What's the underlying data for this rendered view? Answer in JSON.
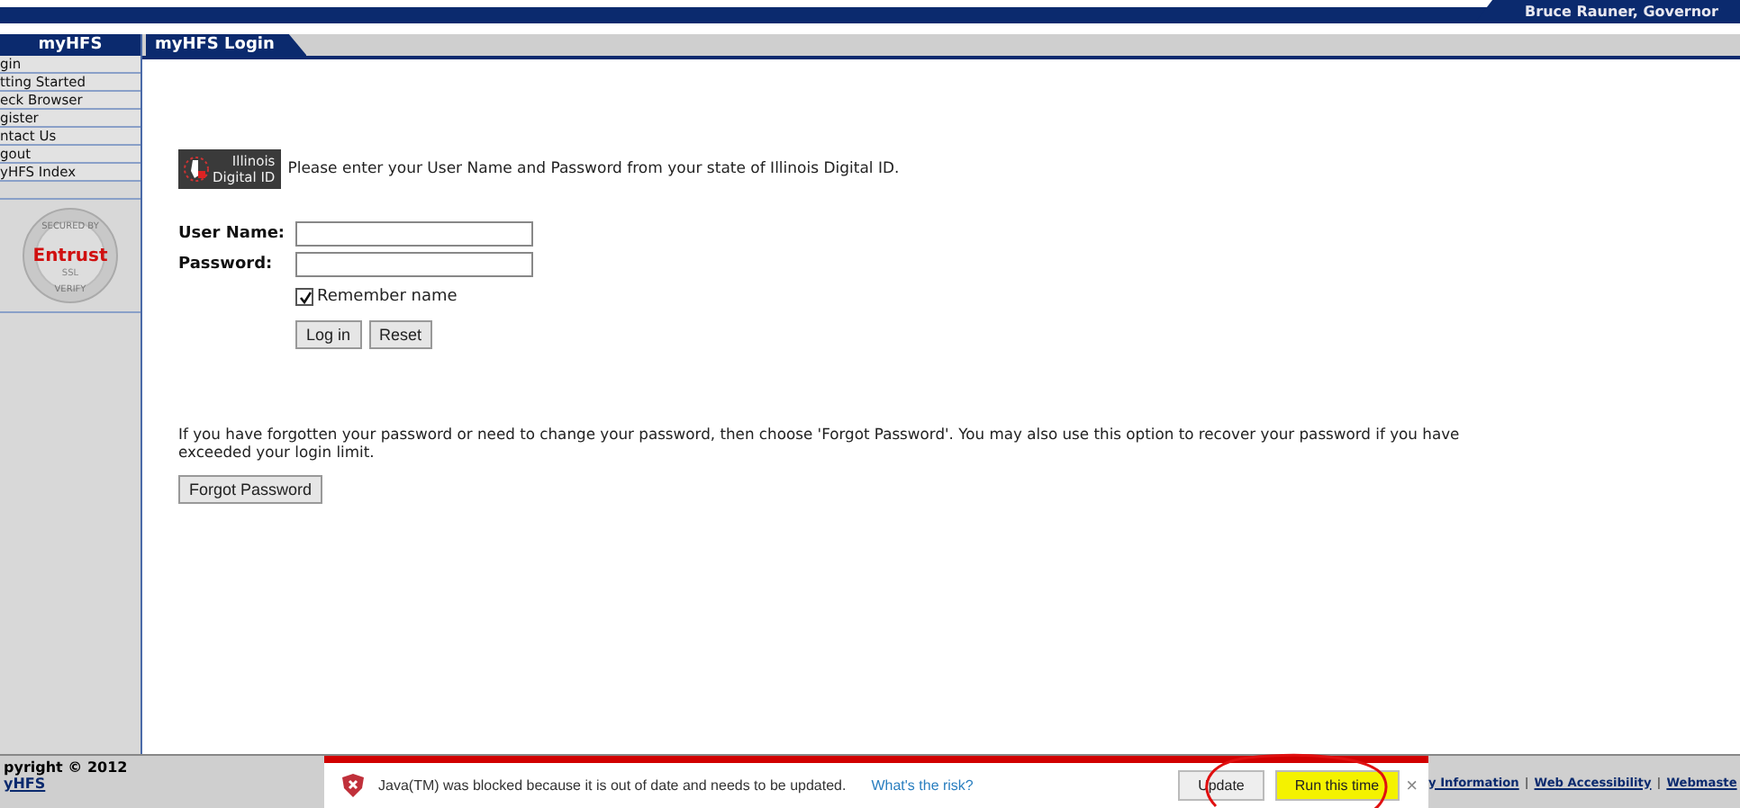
{
  "header": {
    "governor": "Bruce Rauner, Governor"
  },
  "sidebar": {
    "title": "myHFS",
    "items": [
      {
        "label": "gin"
      },
      {
        "label": "tting Started"
      },
      {
        "label": "eck Browser"
      },
      {
        "label": "gister"
      },
      {
        "label": "ntact Us"
      },
      {
        "label": "gout"
      },
      {
        "label": "yHFS Index"
      }
    ],
    "seal": {
      "top": "SECURED BY",
      "brand": "Entrust",
      "middle": "SSL",
      "bottom": "VERIFY"
    }
  },
  "tab": {
    "label": "myHFS Login"
  },
  "login": {
    "badge_line1": "Illinois",
    "badge_line2": "Digital ID",
    "intro": "Please enter your User Name and Password from your state of Illinois Digital ID.",
    "username_label": "User Name:",
    "password_label": "Password:",
    "remember": {
      "label": "Remember name",
      "checked": true
    },
    "buttons": [
      "Log in",
      "Reset"
    ]
  },
  "forgot": {
    "text": "If you have forgotten your password or need to change your password, then choose 'Forgot Password'. You may also use this option to recover your password if you have exceeded your login limit.",
    "button": "Forgot Password"
  },
  "footer": {
    "copyright": "pyright © 2012",
    "owner": "yHFS",
    "links": [
      "y Information",
      "Web Accessibility",
      "Webmaste"
    ],
    "separator": "|"
  },
  "notification": {
    "message": "Java(TM) was blocked because it is out of date and needs to be updated.",
    "link": "What's the risk?",
    "buttons": [
      {
        "label": "Update",
        "highlighted": false
      },
      {
        "label": "Run this time",
        "highlighted": true
      }
    ],
    "close": "×"
  }
}
